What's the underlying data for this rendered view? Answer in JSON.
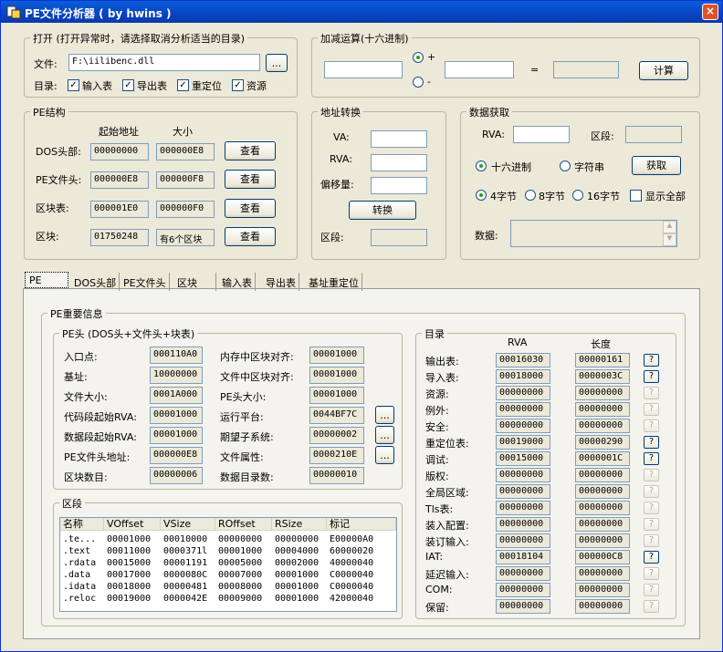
{
  "window": {
    "title": "PE文件分析器 ( by hwins )",
    "close": "×"
  },
  "open": {
    "group_label": "打开 (打开异常时，请选择取消分析适当的目录)",
    "file_label": "文件:",
    "file_value": "F:\\iilibenc.dll",
    "browse": "...",
    "dir_label": "目录:",
    "checks": [
      "输入表",
      "导出表",
      "重定位",
      "资源"
    ]
  },
  "arith": {
    "group_label": "加减运算(十六进制)",
    "plus": "+",
    "minus": "-",
    "equals": "=",
    "calc": "计算"
  },
  "pe": {
    "group_label": "PE结构",
    "col_start": "起始地址",
    "col_size": "大小",
    "rows": [
      {
        "label": "DOS头部:",
        "start": "00000000",
        "size": "000000E8",
        "btn": "查看"
      },
      {
        "label": "PE文件头:",
        "start": "000000E8",
        "size": "000000F8",
        "btn": "查看"
      },
      {
        "label": "区块表:",
        "start": "000001E0",
        "size": "000000F0",
        "btn": "查看"
      },
      {
        "label": "区块:",
        "start": "01750248",
        "size": "有6个区块",
        "btn": "查看"
      }
    ]
  },
  "addr": {
    "group_label": "地址转换",
    "va": "VA:",
    "rva": "RVA:",
    "offset": "偏移量:",
    "convert": "转换",
    "section": "区段:"
  },
  "fetch": {
    "group_label": "数据获取",
    "rva": "RVA:",
    "section": "区段:",
    "hex": "十六进制",
    "str": "字符串",
    "get": "获取",
    "b4": "4字节",
    "b8": "8字节",
    "b16": "16字节",
    "showall": "显示全部",
    "data": "数据:"
  },
  "tabs": [
    "PE",
    "DOS头部",
    "PE文件头",
    "区块",
    "输入表",
    "导出表",
    "基址重定位"
  ],
  "info": {
    "group_label": "PE重要信息",
    "header_label": "PE头 (DOS头+文件头+块表)",
    "left": [
      {
        "label": "入口点:",
        "value": "000110A0"
      },
      {
        "label": "基址:",
        "value": "10000000"
      },
      {
        "label": "文件大小:",
        "value": "0001A000"
      },
      {
        "label": "代码段起始RVA:",
        "value": "00001000"
      },
      {
        "label": "数据段起始RVA:",
        "value": "00001000"
      },
      {
        "label": "PE文件头地址:",
        "value": "000000E8"
      },
      {
        "label": "区块数目:",
        "value": "00000006"
      }
    ],
    "right": [
      {
        "label": "内存中区块对齐:",
        "value": "00001000",
        "btn": ""
      },
      {
        "label": "文件中区块对齐:",
        "value": "00001000",
        "btn": ""
      },
      {
        "label": "PE头大小:",
        "value": "00001000",
        "btn": ""
      },
      {
        "label": "运行平台:",
        "value": "0044BF7C",
        "btn": "..."
      },
      {
        "label": "期望子系统:",
        "value": "00000002",
        "btn": "..."
      },
      {
        "label": "文件属性:",
        "value": "0000210E",
        "btn": "..."
      },
      {
        "label": "数据目录数:",
        "value": "00000010",
        "btn": ""
      }
    ],
    "sections_label": "区段",
    "sec_cols": [
      "名称",
      "VOffset",
      "VSize",
      "ROffset",
      "RSize",
      "标记"
    ],
    "sec_rows": [
      [
        ".te...",
        "00001000",
        "00010000",
        "00000000",
        "00000000",
        "E00000A0"
      ],
      [
        ".text",
        "00011000",
        "0000371l",
        "00001000",
        "00004000",
        "60000020"
      ],
      [
        ".rdata",
        "00015000",
        "00001191",
        "00005000",
        "00002000",
        "40000040"
      ],
      [
        ".data",
        "00017000",
        "0000080C",
        "00007000",
        "00001000",
        "C0000040"
      ],
      [
        ".idata",
        "00018000",
        "00000481",
        "00008000",
        "00001000",
        "C0000040"
      ],
      [
        ".reloc",
        "00019000",
        "0000042E",
        "00009000",
        "00001000",
        "42000040"
      ]
    ],
    "dir_label": "目录",
    "dir_col_rva": "RVA",
    "dir_col_len": "长度",
    "q": "?",
    "dirs": [
      {
        "label": "输出表:",
        "rva": "00016030",
        "len": "00000161",
        "active": true
      },
      {
        "label": "导入表:",
        "rva": "00018000",
        "len": "0000003C",
        "active": true
      },
      {
        "label": "资源:",
        "rva": "00000000",
        "len": "00000000",
        "active": false
      },
      {
        "label": "例外:",
        "rva": "00000000",
        "len": "00000000",
        "active": false
      },
      {
        "label": "安全:",
        "rva": "00000000",
        "len": "00000000",
        "active": false
      },
      {
        "label": "重定位表:",
        "rva": "00019000",
        "len": "00000290",
        "active": true
      },
      {
        "label": "调试:",
        "rva": "00015000",
        "len": "0000001C",
        "active": true
      },
      {
        "label": "版权:",
        "rva": "00000000",
        "len": "00000000",
        "active": false
      },
      {
        "label": "全局区域:",
        "rva": "00000000",
        "len": "00000000",
        "active": false
      },
      {
        "label": "Tls表:",
        "rva": "00000000",
        "len": "00000000",
        "active": false
      },
      {
        "label": "装入配置:",
        "rva": "00000000",
        "len": "00000000",
        "active": false
      },
      {
        "label": "装订输入:",
        "rva": "00000000",
        "len": "00000000",
        "active": false
      },
      {
        "label": "IAT:",
        "rva": "00018104",
        "len": "000000C8",
        "active": true
      },
      {
        "label": "延迟输入:",
        "rva": "00000000",
        "len": "00000000",
        "active": false
      },
      {
        "label": "COM:",
        "rva": "00000000",
        "len": "00000000",
        "active": false
      },
      {
        "label": "保留:",
        "rva": "00000000",
        "len": "00000000",
        "active": false
      }
    ]
  }
}
